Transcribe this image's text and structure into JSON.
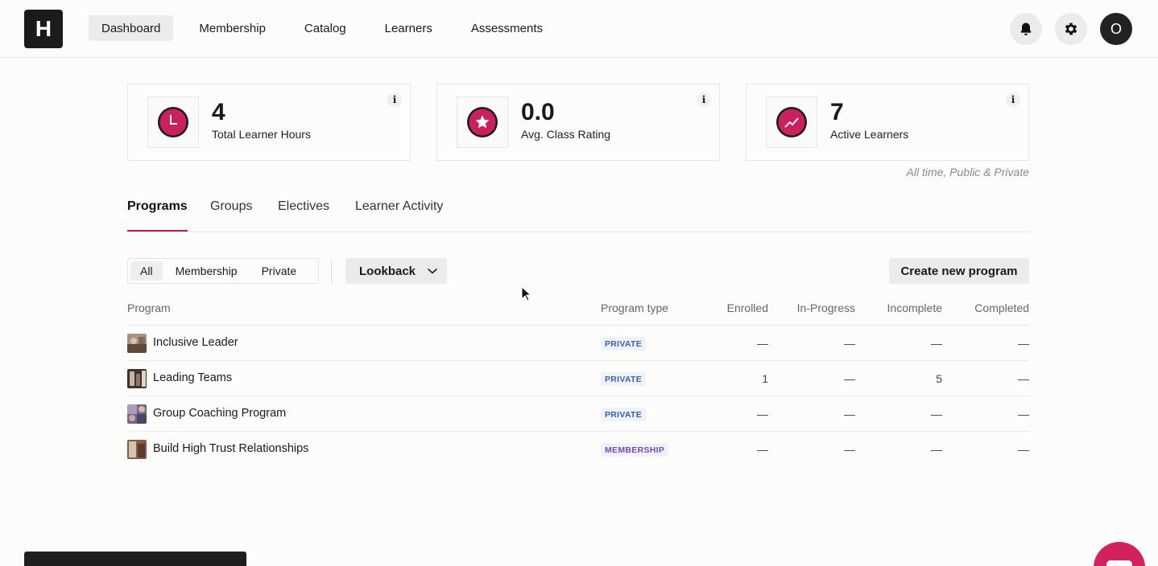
{
  "app": {
    "logo_letter": "H"
  },
  "nav": {
    "items": [
      {
        "label": "Dashboard",
        "active": true
      },
      {
        "label": "Membership",
        "active": false
      },
      {
        "label": "Catalog",
        "active": false
      },
      {
        "label": "Learners",
        "active": false
      },
      {
        "label": "Assessments",
        "active": false
      }
    ],
    "avatar_initial": "O",
    "icons": [
      "bell-icon",
      "gear-icon"
    ]
  },
  "stats": [
    {
      "value": "4",
      "label": "Total Learner Hours",
      "icon": "clock-icon"
    },
    {
      "value": "0.0",
      "label": "Avg. Class Rating",
      "icon": "star-icon"
    },
    {
      "value": "7",
      "label": "Active Learners",
      "icon": "trend-icon"
    }
  ],
  "stats_info_glyph": "i",
  "scope_note": "All time, Public & Private",
  "accent_color": "#c21a5a",
  "tabs": [
    {
      "label": "Programs",
      "active": true
    },
    {
      "label": "Groups",
      "active": false
    },
    {
      "label": "Electives",
      "active": false
    },
    {
      "label": "Learner Activity",
      "active": false
    }
  ],
  "filters": {
    "segments": [
      {
        "label": "All",
        "active": true
      },
      {
        "label": "Membership",
        "active": false
      },
      {
        "label": "Private",
        "active": false
      }
    ],
    "lookback_label": "Lookback",
    "create_label": "Create new program"
  },
  "table": {
    "headers": {
      "program": "Program",
      "type": "Program type",
      "enrolled": "Enrolled",
      "in_progress": "In-Progress",
      "incomplete": "Incomplete",
      "completed": "Completed"
    },
    "rows": [
      {
        "name": "Inclusive Leader",
        "type": "PRIVATE",
        "enrolled": "—",
        "in_progress": "—",
        "incomplete": "—",
        "completed": "—"
      },
      {
        "name": "Leading Teams",
        "type": "PRIVATE",
        "enrolled": "1",
        "in_progress": "—",
        "incomplete": "5",
        "completed": "—"
      },
      {
        "name": "Group Coaching Program",
        "type": "PRIVATE",
        "enrolled": "—",
        "in_progress": "—",
        "incomplete": "—",
        "completed": "—"
      },
      {
        "name": "Build High Trust Relationships",
        "type": "MEMBERSHIP",
        "enrolled": "—",
        "in_progress": "—",
        "incomplete": "—",
        "completed": "—"
      }
    ]
  }
}
